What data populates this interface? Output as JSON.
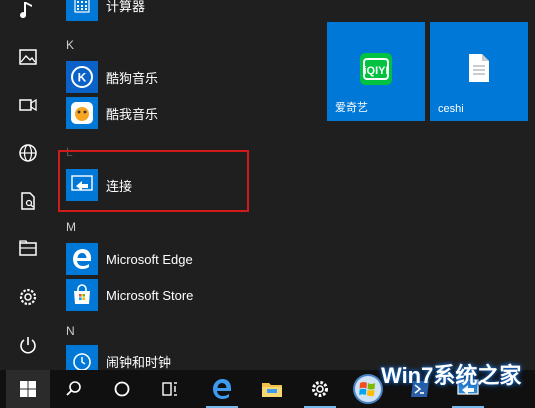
{
  "rail": {
    "items": [
      {
        "icon": "music-icon"
      },
      {
        "icon": "pictures-icon"
      },
      {
        "icon": "videos-icon"
      },
      {
        "icon": "network-icon"
      },
      {
        "icon": "documents-icon"
      },
      {
        "icon": "file-explorer-icon"
      },
      {
        "icon": "settings-icon"
      },
      {
        "icon": "power-icon"
      }
    ]
  },
  "apps": {
    "calculator": "计算器",
    "letter_k": "K",
    "kugou": "酷狗音乐",
    "kuwo": "酷我音乐",
    "letter_l": "L",
    "connect": "连接",
    "letter_m": "M",
    "edge": "Microsoft Edge",
    "store": "Microsoft Store",
    "letter_n": "N",
    "alarms": "闹钟和时钟"
  },
  "tiles": [
    {
      "label": "爱奇艺",
      "icon": "iqiyi-icon",
      "color": "#0078d7"
    },
    {
      "label": "ceshi",
      "icon": "document-icon",
      "color": "#0078d7"
    }
  ],
  "taskbar": {
    "items": [
      "start-icon",
      "search-icon",
      "cortana-icon",
      "task-view-icon",
      "edge-icon",
      "file-explorer-icon",
      "settings-icon",
      "windows7-icon",
      "powershell-icon",
      "connect-icon"
    ]
  },
  "watermark": {
    "text": "Win7系统之家"
  },
  "colors": {
    "accent": "#0078d7",
    "highlight": "#d11a1a",
    "background": "#1f1f1f"
  }
}
